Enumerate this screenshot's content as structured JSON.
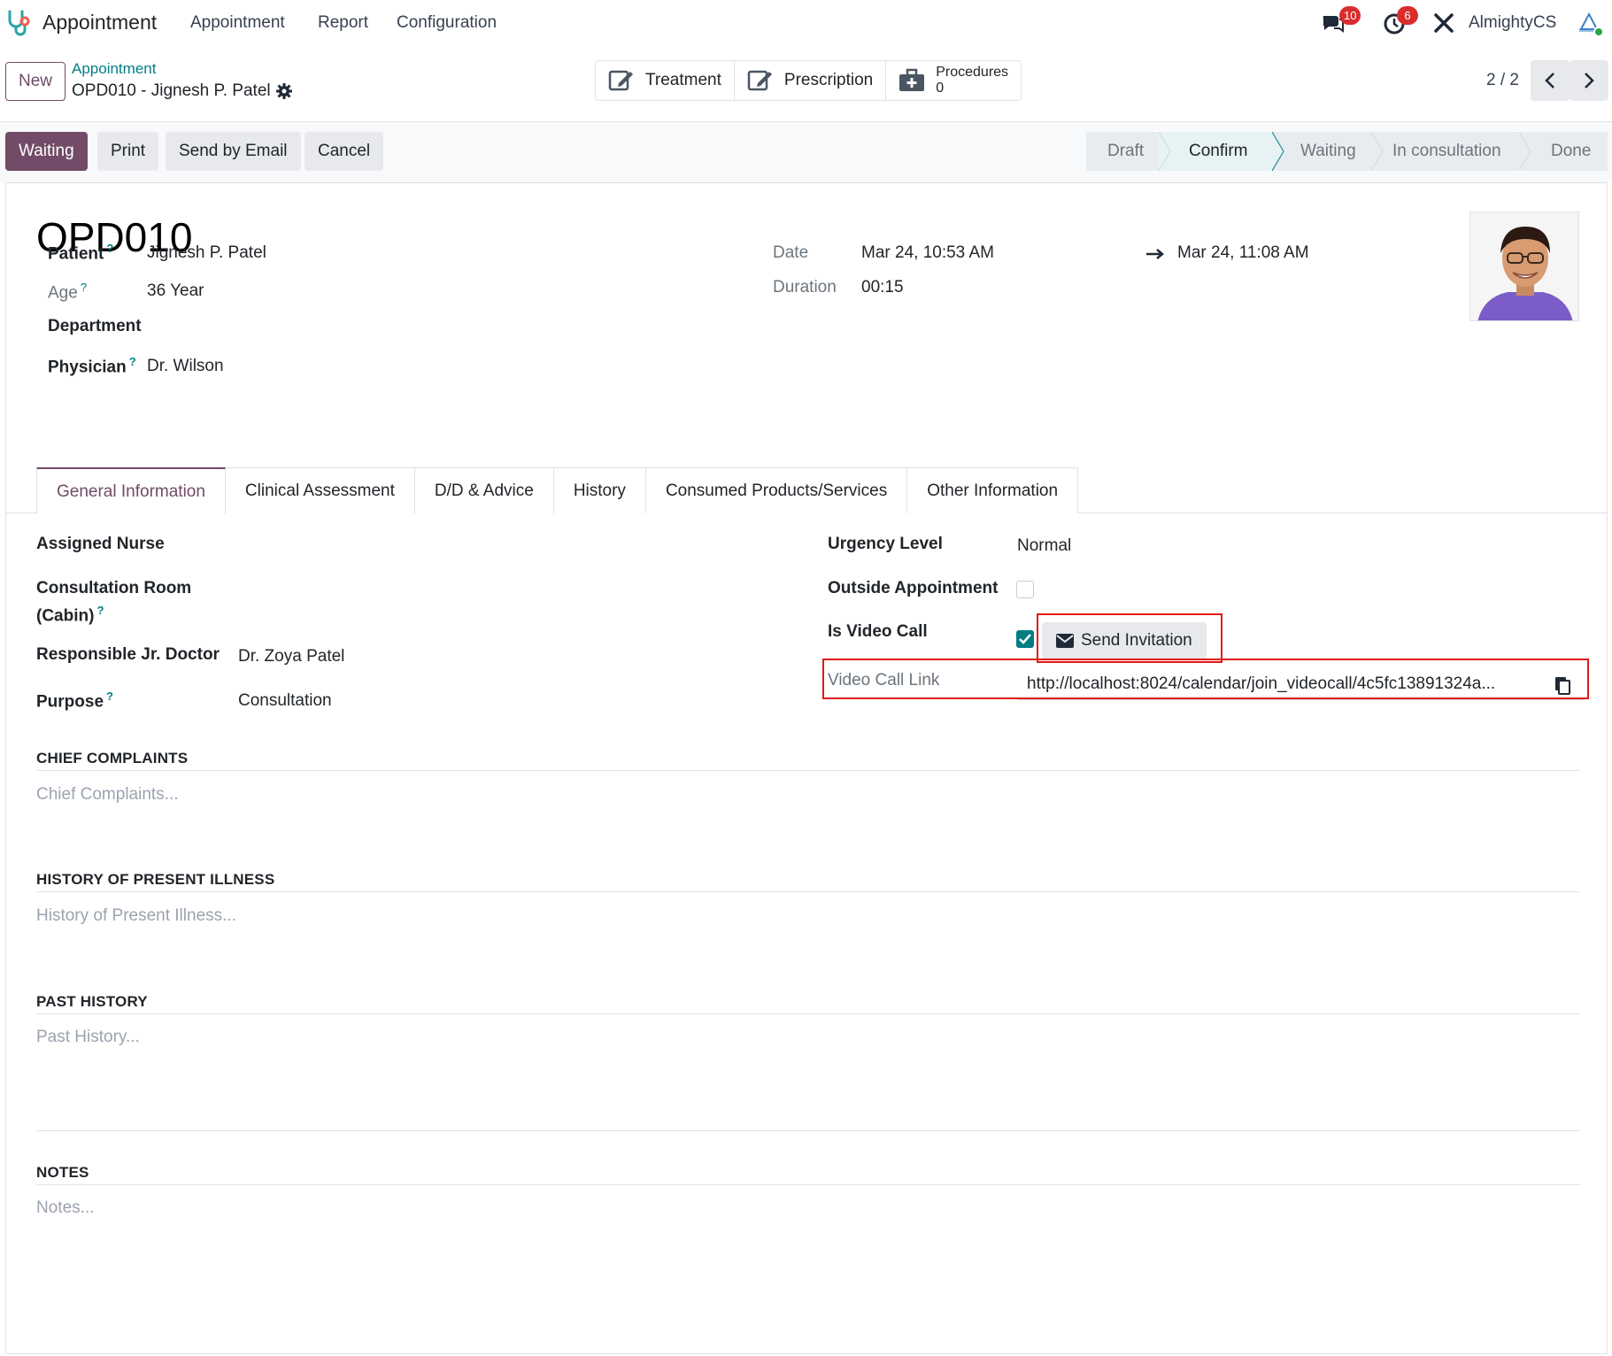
{
  "nav": {
    "app_name": "Appointment",
    "menu": [
      "Appointment",
      "Report",
      "Configuration"
    ],
    "messages_count": "10",
    "activities_count": "6",
    "user_name": "AlmightyCS"
  },
  "control_panel": {
    "new_label": "New",
    "breadcrumb_parent": "Appointment",
    "breadcrumb_current": "OPD010 - Jignesh P. Patel",
    "smart_buttons": {
      "treatment": "Treatment",
      "prescription": "Prescription",
      "procedures_label": "Procedures",
      "procedures_count": "0"
    },
    "pager": "2 / 2"
  },
  "statusbar": {
    "actions": [
      "Waiting",
      "Print",
      "Send by Email",
      "Cancel"
    ],
    "stages": [
      "Draft",
      "Confirm",
      "Waiting",
      "In consultation",
      "Done"
    ],
    "current_stage": "Confirm"
  },
  "record": {
    "title": "OPD010",
    "patient_label": "Patient",
    "patient": "Jignesh P. Patel",
    "age_label": "Age",
    "age": "36 Year",
    "department_label": "Department",
    "physician_label": "Physician",
    "physician": "Dr. Wilson",
    "date_label": "Date",
    "date_start": "Mar 24, 10:53 AM",
    "date_end": "Mar 24, 11:08 AM",
    "duration_label": "Duration",
    "duration": "00:15"
  },
  "tabs": [
    "General Information",
    "Clinical Assessment",
    "D/D & Advice",
    "History",
    "Consumed Products/Services",
    "Other Information"
  ],
  "general": {
    "assigned_nurse_label": "Assigned Nurse",
    "room_label_1": "Consultation Room",
    "room_label_2": "(Cabin)",
    "jr_doctor_label": "Responsible Jr. Doctor",
    "jr_doctor": "Dr. Zoya Patel",
    "purpose_label": "Purpose",
    "purpose": "Consultation",
    "urgency_label": "Urgency Level",
    "urgency": "Normal",
    "outside_label": "Outside Appointment",
    "video_call_label": "Is Video Call",
    "send_invitation": "Send Invitation",
    "video_link_label": "Video Call Link",
    "video_link": "http://localhost:8024/calendar/join_videocall/4c5fc13891324a..."
  },
  "sections": {
    "chief_title": "CHIEF COMPLAINTS",
    "chief_ph": "Chief Complaints...",
    "hpi_title": "HISTORY OF PRESENT ILLNESS",
    "hpi_ph": "History of Present Illness...",
    "past_title": "PAST HISTORY",
    "past_ph": "Past History...",
    "notes_title": "NOTES",
    "notes_ph": "Notes..."
  },
  "colors": {
    "brand": "#714b67",
    "accent": "#017e84",
    "highlight": "#e21a1a"
  }
}
